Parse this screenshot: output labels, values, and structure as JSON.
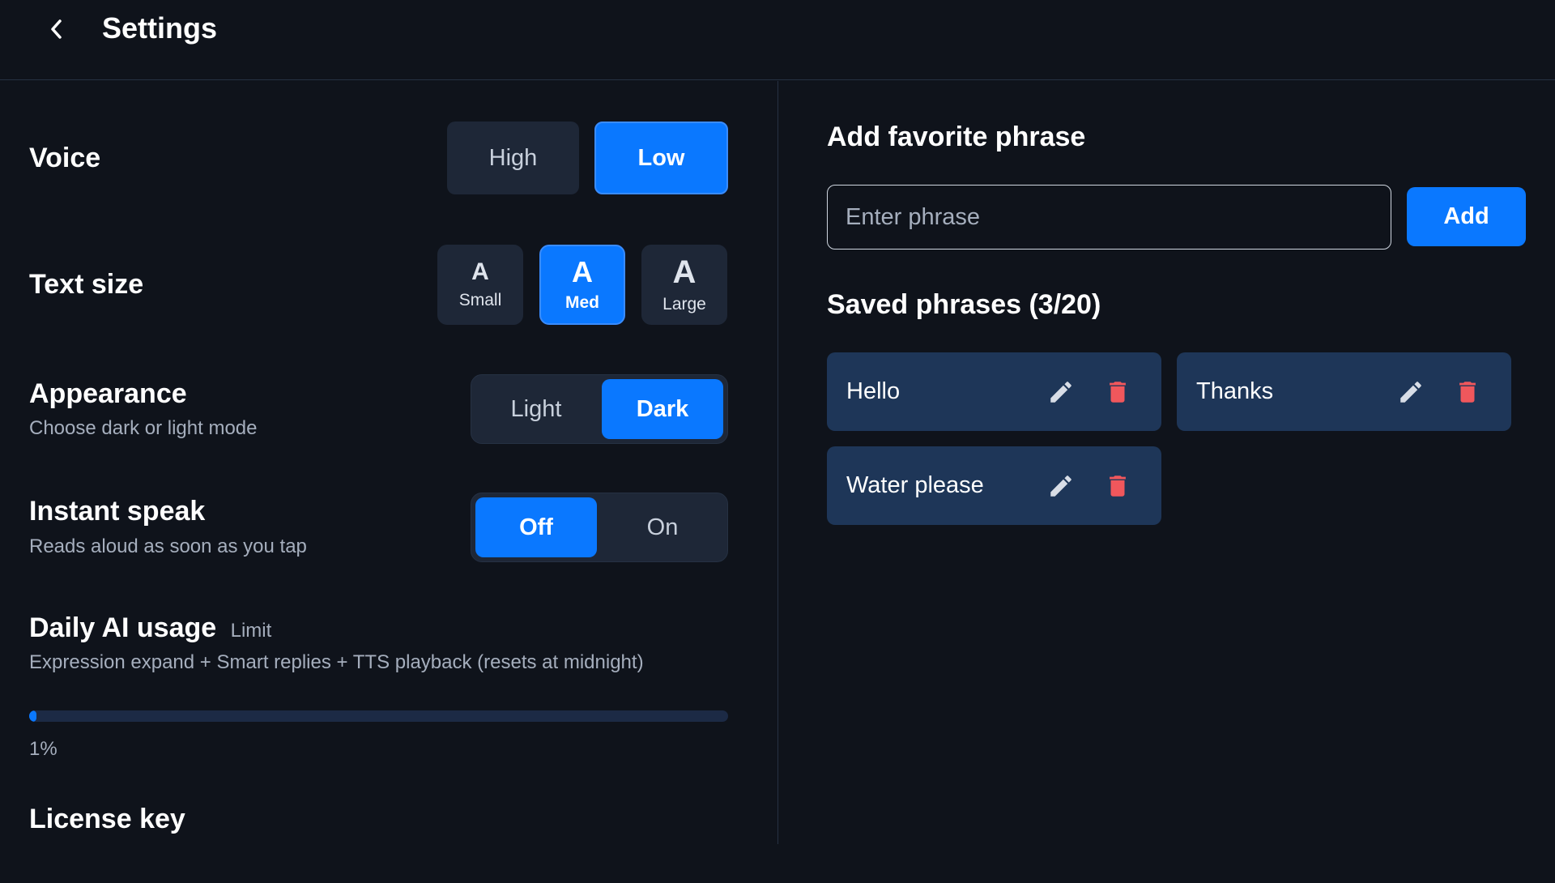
{
  "header": {
    "title": "Settings",
    "back_icon": "chevron-left-icon"
  },
  "voice": {
    "label": "Voice",
    "options": [
      "High",
      "Low"
    ],
    "selected": "Low"
  },
  "text_size": {
    "label": "Text size",
    "glyph": "A",
    "options": [
      "Small",
      "Med",
      "Large"
    ],
    "selected": "Med"
  },
  "appearance": {
    "label": "Appearance",
    "description": "Choose dark or light mode",
    "options": [
      "Light",
      "Dark"
    ],
    "selected": "Dark"
  },
  "instant_speak": {
    "label": "Instant speak",
    "description": "Reads aloud as soon as you tap",
    "options": [
      "Off",
      "On"
    ],
    "selected": "Off"
  },
  "ai_usage": {
    "label": "Daily AI usage",
    "tag": "Limit",
    "description": "Expression expand + Smart replies + TTS playback (resets at midnight)",
    "percent": 1,
    "percent_text": "1%"
  },
  "license": {
    "label": "License key"
  },
  "favorites": {
    "title": "Add favorite phrase",
    "input_placeholder": "Enter phrase",
    "input_value": "",
    "add_label": "Add",
    "saved_title": "Saved phrases (3/20)",
    "phrases": [
      "Hello",
      "Thanks",
      "Water please"
    ]
  },
  "colors": {
    "background": "#0f131b",
    "accent": "#0a78ff",
    "card": "#1e3658",
    "control": "#1e2737",
    "delete": "#f0575c",
    "edit": "#d8dde6"
  }
}
